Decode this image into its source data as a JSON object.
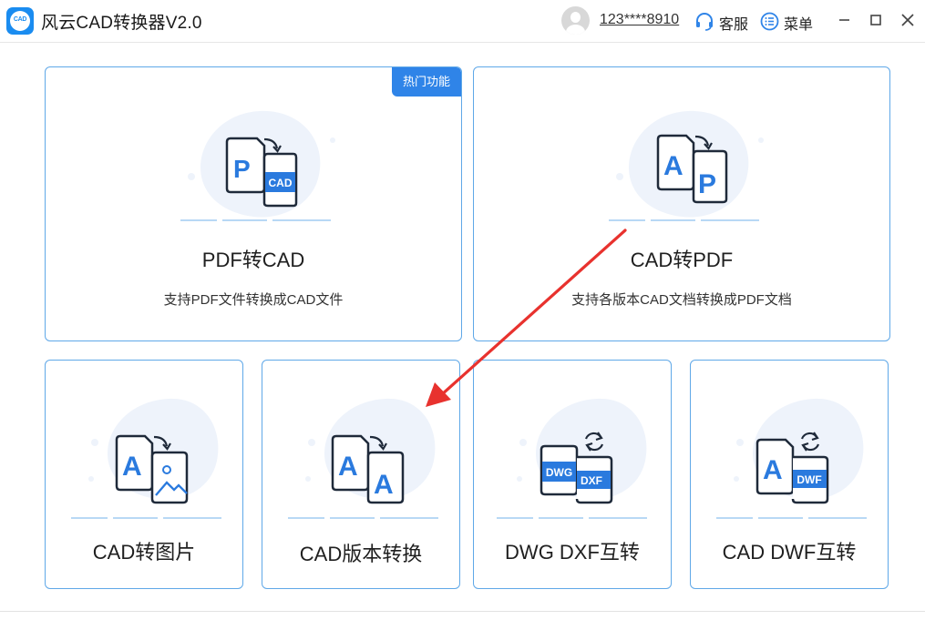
{
  "window": {
    "title": "风云CAD转换器V2.0",
    "logo_text": "CAD"
  },
  "header": {
    "user_phone": "123****8910",
    "service_label": "客服",
    "menu_label": "菜单"
  },
  "cards": {
    "pdf_to_cad": {
      "title": "PDF转CAD",
      "description": "支持PDF文件转换成CAD文件",
      "badge": "热门功能",
      "icon_front": "CAD",
      "icon_back": "P"
    },
    "cad_to_pdf": {
      "title": "CAD转PDF",
      "description": "支持各版本CAD文档转换成PDF文档",
      "icon_front": "P",
      "icon_back": "A"
    },
    "cad_to_image": {
      "title": "CAD转图片",
      "icon_back": "A"
    },
    "cad_version": {
      "title": "CAD版本转换",
      "icon_back": "A",
      "icon_front": "A"
    },
    "dwg_dxf": {
      "title": "DWG DXF互转",
      "icon_back": "DWG",
      "icon_front": "DXF"
    },
    "cad_dwf": {
      "title": "CAD DWF互转",
      "icon_back": "A",
      "icon_front": "DWF"
    }
  },
  "colors": {
    "accent": "#2f84e8",
    "card_border": "#5fa8e8",
    "icon_blue": "#2a7ade",
    "icon_outline": "#1f2a3a",
    "annotation_arrow": "#e8322e",
    "blob": "#eef3fb"
  }
}
